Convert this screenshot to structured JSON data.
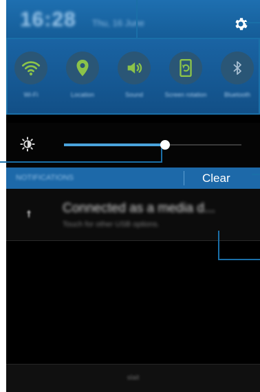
{
  "status_bar": {
    "time": "16:28",
    "date": "Thu, 16 June",
    "settings_icon": "gear-icon"
  },
  "quick_settings": [
    {
      "label": "Wi-Fi",
      "icon": "wifi-icon",
      "active": true
    },
    {
      "label": "Location",
      "icon": "location-pin-icon",
      "active": true
    },
    {
      "label": "Sound",
      "icon": "speaker-icon",
      "active": true
    },
    {
      "label": "Screen rotation",
      "icon": "screen-rotation-icon",
      "active": true
    },
    {
      "label": "Bluetooth",
      "icon": "bluetooth-icon",
      "active": false
    }
  ],
  "brightness": {
    "icon": "brightness-sun-icon",
    "level": 0.57
  },
  "notifications": {
    "header": "NOTIFICATIONS",
    "clear_label": "Clear",
    "items": [
      {
        "icon": "usb-icon",
        "title": "Connected as a media d...",
        "subtitle": "Touch for other USB options."
      }
    ]
  },
  "bottom_bar": {
    "carrier": "slait"
  },
  "colors": {
    "accent": "#1d69a9",
    "toggle_active": "#8bc34a",
    "slider": "#4aa3dc",
    "callout": "#1a6fa8"
  }
}
